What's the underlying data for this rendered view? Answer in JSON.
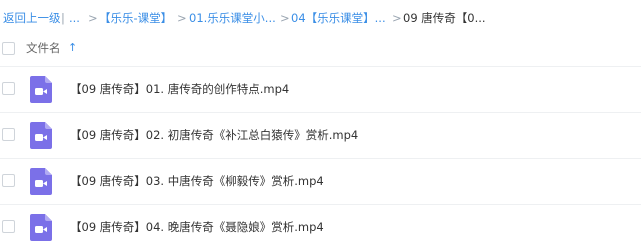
{
  "breadcrumb": {
    "back": "返回上一级",
    "sep1": "|",
    "ellipsis": "...",
    "sep2": ">",
    "item1": "【乐乐-课堂】",
    "sep3": ">",
    "item2": "01.乐乐课堂小...",
    "sep4": ">",
    "item3": "04【乐乐课堂】...",
    "sep5": ">",
    "current": "09 唐传奇【0..."
  },
  "list_header": {
    "column_label": "文件名",
    "sort_icon": "arrow-up-icon",
    "sort_glyph": "↑"
  },
  "files": [
    {
      "name": "【09 唐传奇】01. 唐传奇的创作特点.mp4",
      "icon": "video-file-icon"
    },
    {
      "name": "【09 唐传奇】02. 初唐传奇《补江总白猿传》赏析.mp4",
      "icon": "video-file-icon"
    },
    {
      "name": "【09 唐传奇】03. 中唐传奇《柳毅传》赏析.mp4",
      "icon": "video-file-icon"
    },
    {
      "name": "【09 唐传奇】04. 晚唐传奇《聂隐娘》赏析.mp4",
      "icon": "video-file-icon"
    }
  ],
  "colors": {
    "accent": "#3a8ee6",
    "video_icon": "#7b70e8"
  }
}
